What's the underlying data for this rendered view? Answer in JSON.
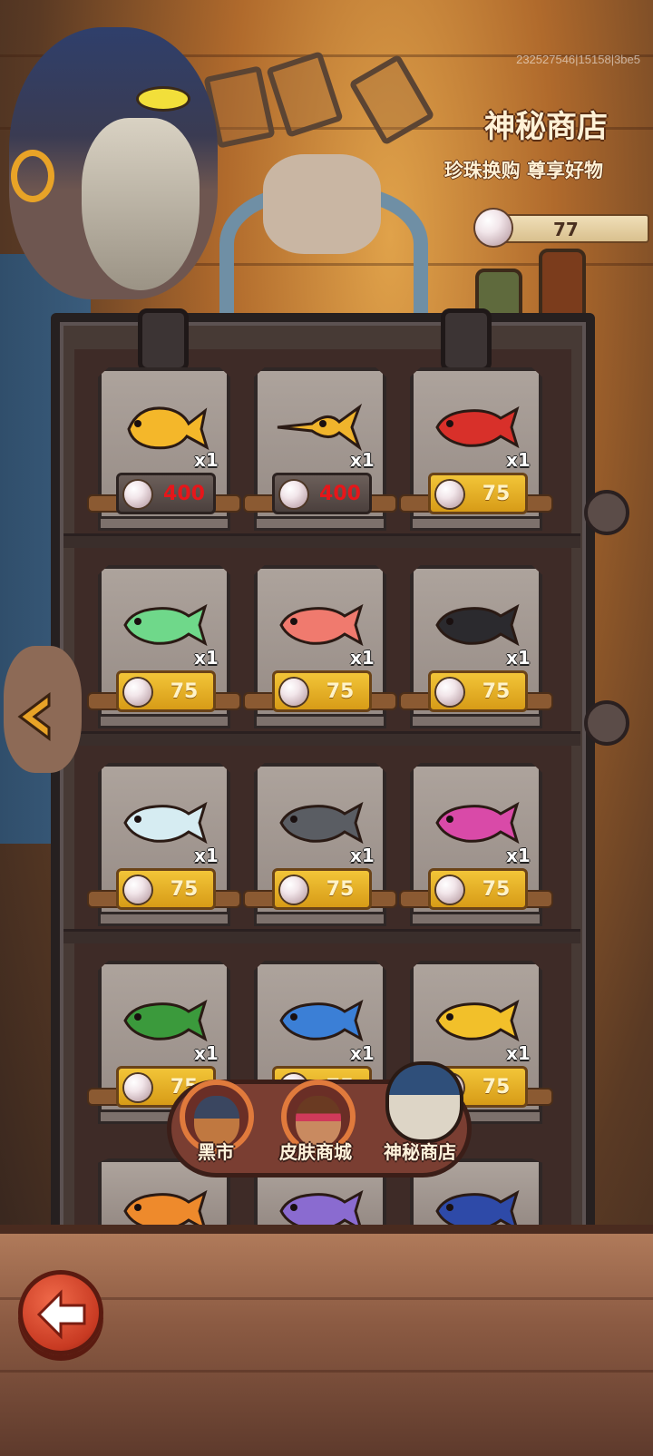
{
  "build_id": "232527546|15158|3be5",
  "header": {
    "title": "神秘商店",
    "subtitle": "珍珠换购 尊享好物"
  },
  "currency": {
    "icon": "pearl-icon",
    "amount": "77"
  },
  "items": [
    {
      "fish": "gold-fish",
      "color": "#f4b72a",
      "qty": "x1",
      "price": "400",
      "locked": true
    },
    {
      "fish": "swordfish",
      "color": "#f0b42c",
      "qty": "x1",
      "price": "400",
      "locked": true
    },
    {
      "fish": "red-arowana",
      "color": "#d8302a",
      "qty": "x1",
      "price": "75",
      "locked": false
    },
    {
      "fish": "green-arowana",
      "color": "#6fd88a",
      "qty": "x1",
      "price": "75",
      "locked": false
    },
    {
      "fish": "pink-arowana",
      "color": "#f07a6e",
      "qty": "x1",
      "price": "75",
      "locked": false
    },
    {
      "fish": "black-arowana",
      "color": "#2b2a2e",
      "qty": "x1",
      "price": "75",
      "locked": false
    },
    {
      "fish": "white-arowana",
      "color": "#d6ecf2",
      "qty": "x1",
      "price": "75",
      "locked": false
    },
    {
      "fish": "silver-black-arowana",
      "color": "#5a5d63",
      "qty": "x1",
      "price": "75",
      "locked": false
    },
    {
      "fish": "magenta-arowana",
      "color": "#d94aa8",
      "qty": "x1",
      "price": "75",
      "locked": false
    },
    {
      "fish": "green-scale-arowana",
      "color": "#3b9a3c",
      "qty": "x1",
      "price": "75",
      "locked": false
    },
    {
      "fish": "blue-arowana",
      "color": "#3b7fd6",
      "qty": "x1",
      "price": "75",
      "locked": false
    },
    {
      "fish": "yellow-arowana",
      "color": "#f2c02a",
      "qty": "x1",
      "price": "75",
      "locked": false
    },
    {
      "fish": "orange-arowana",
      "color": "#ee8a2c",
      "qty": "",
      "price": "",
      "locked": false
    },
    {
      "fish": "purple-arowana",
      "color": "#8a6bd0",
      "qty": "",
      "price": "",
      "locked": false
    },
    {
      "fish": "navy-arowana",
      "color": "#2e4aa8",
      "qty": "",
      "price": "",
      "locked": false
    }
  ],
  "tabs": [
    {
      "label": "黑市",
      "icon": "black-market-merchant-icon",
      "active": false
    },
    {
      "label": "皮肤商城",
      "icon": "skin-shop-merchant-icon",
      "active": false
    },
    {
      "label": "神秘商店",
      "icon": "mystery-shop-merchant-icon",
      "active": true
    }
  ],
  "nav": {
    "back_icon": "back-arrow-icon",
    "prev_icon": "left-chevron-icon"
  },
  "colors": {
    "price_plate": "#f2c538",
    "locked_price": "#e6161a",
    "back_button": "#d8452a"
  }
}
